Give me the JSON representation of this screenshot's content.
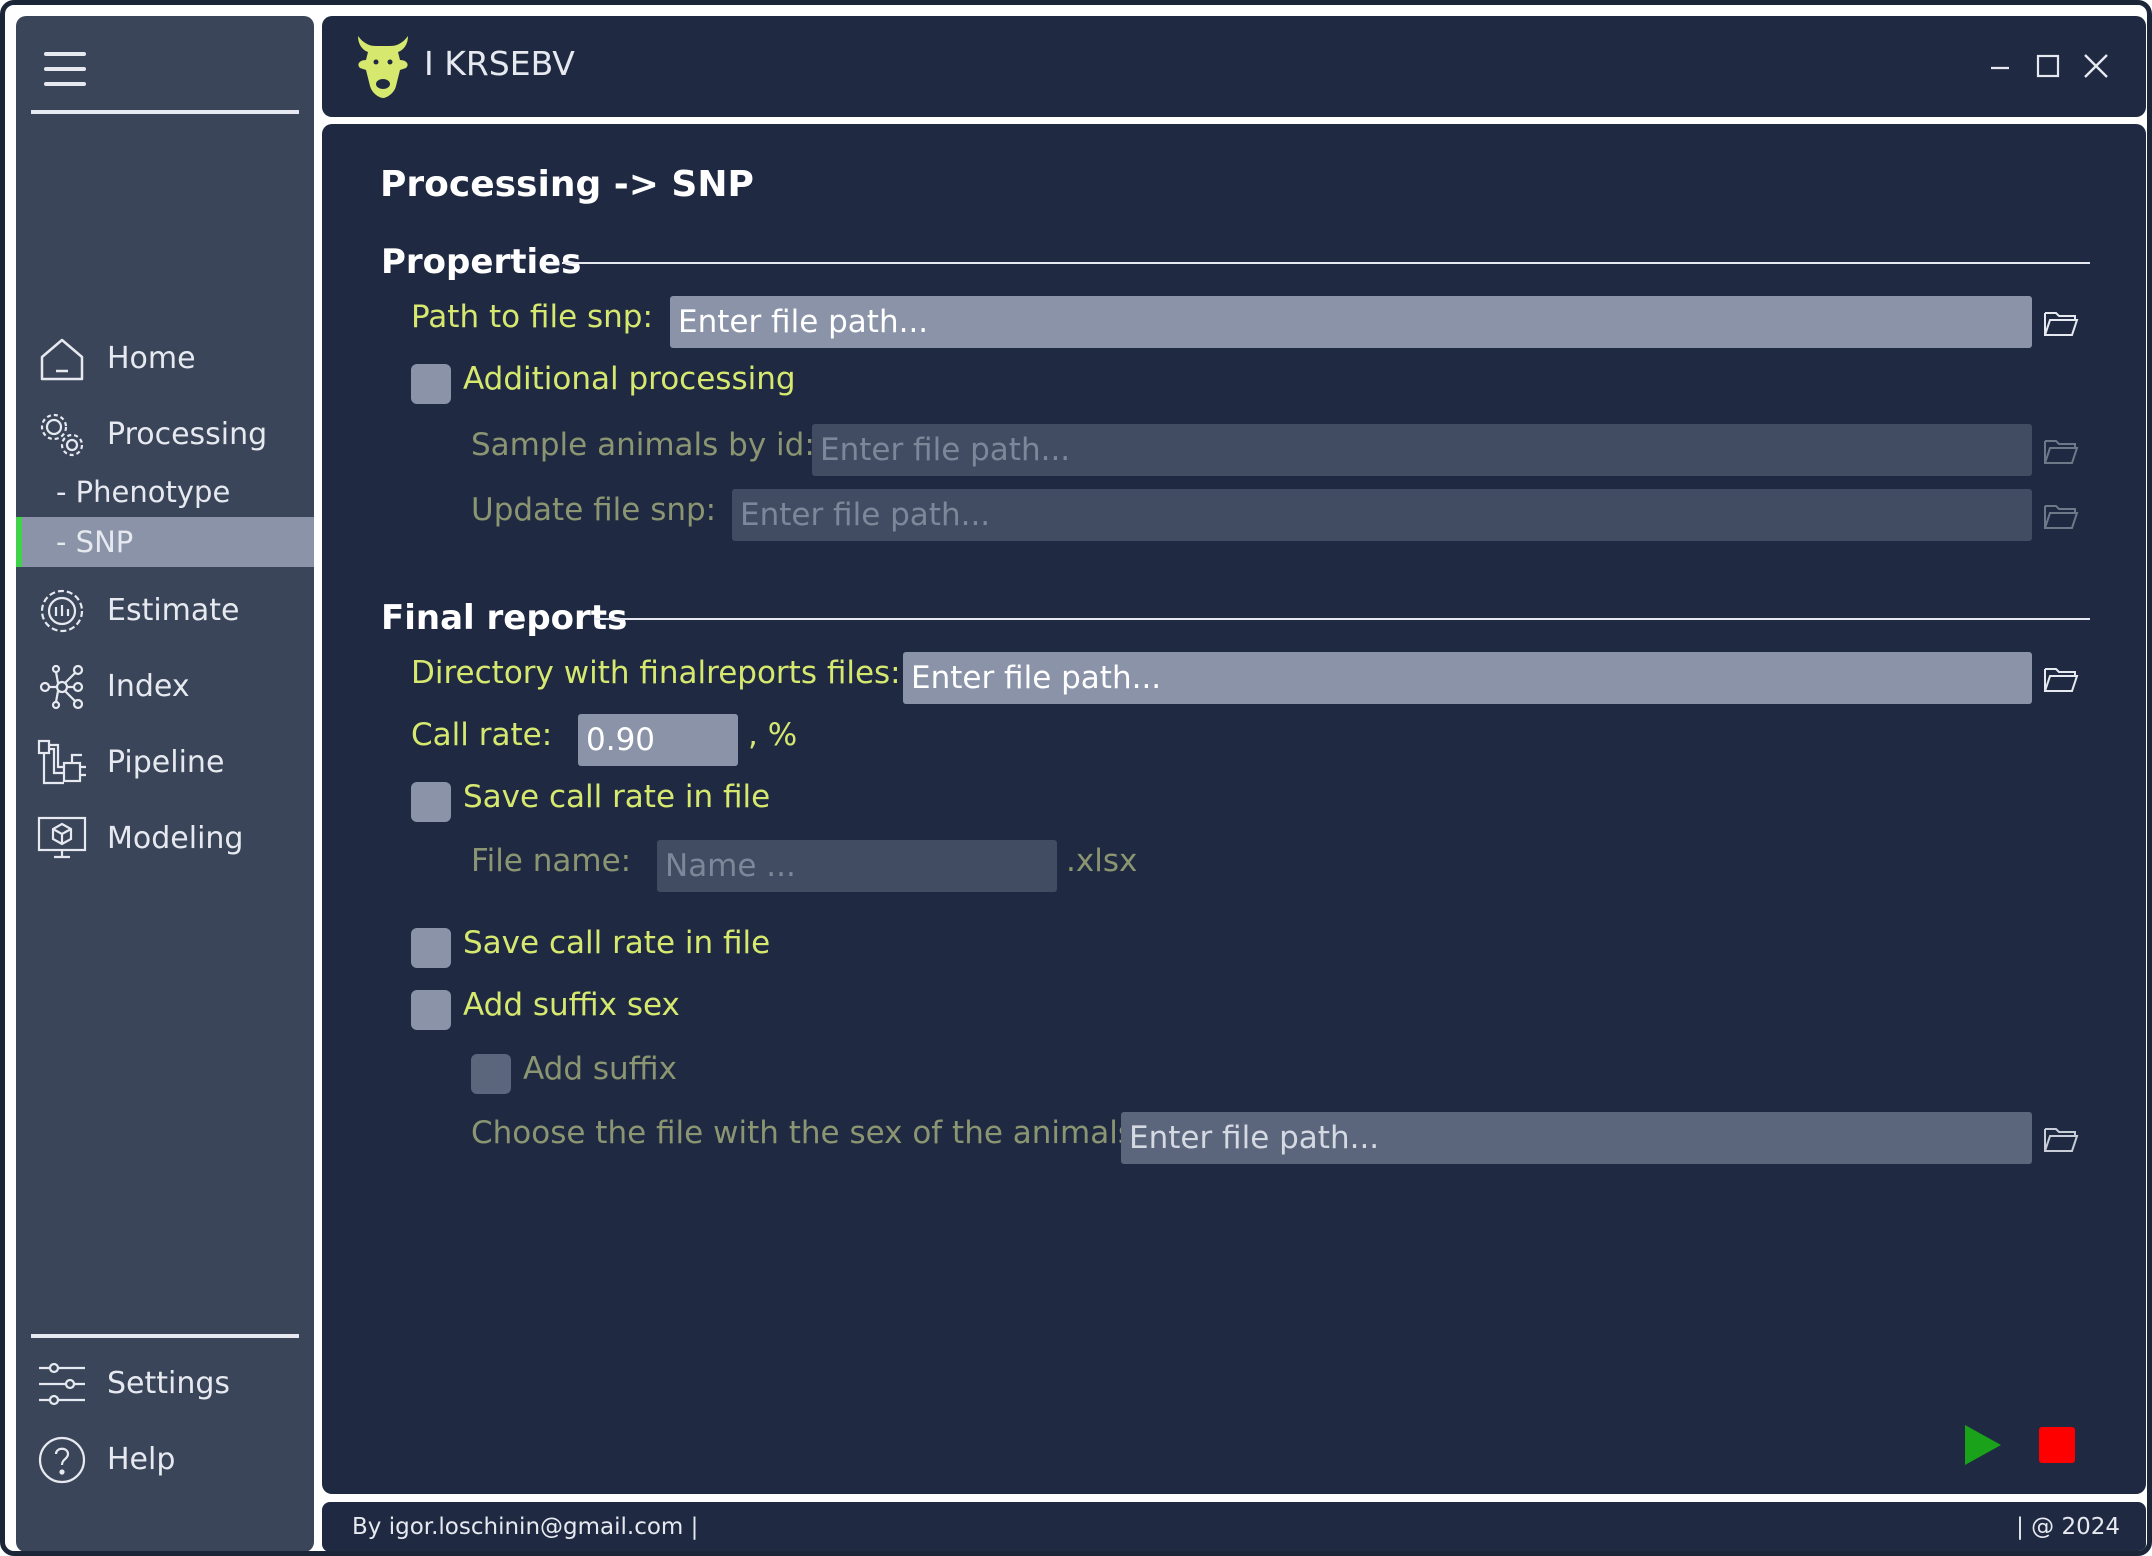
{
  "app": {
    "title": "KRSEBV",
    "title_prefix": "I"
  },
  "sidebar": {
    "items": [
      {
        "label": "Home",
        "icon": "home-icon"
      },
      {
        "label": "Processing",
        "icon": "gears-icon"
      },
      {
        "label": "- Phenotype"
      },
      {
        "label": "- SNP",
        "active": true
      },
      {
        "label": "Estimate",
        "icon": "estimate-icon"
      },
      {
        "label": "Index",
        "icon": "index-icon"
      },
      {
        "label": "Pipeline",
        "icon": "pipeline-icon"
      },
      {
        "label": "Modeling",
        "icon": "modeling-icon"
      }
    ],
    "bottom": [
      {
        "label": "Settings",
        "icon": "sliders-icon"
      },
      {
        "label": "Help",
        "icon": "help-icon"
      }
    ]
  },
  "page": {
    "title": "Processing -> SNP",
    "properties": {
      "title": "Properties",
      "path_label": "Path to file snp:",
      "path_placeholder": "Enter file path...",
      "additional_label": "Additional processing",
      "sample_label": "Sample animals by id:",
      "sample_placeholder": "Enter file path...",
      "update_label": "Update file snp:",
      "update_placeholder": "Enter file path..."
    },
    "final_reports": {
      "title": "Final reports",
      "dir_label": "Directory with finalreports files:",
      "dir_placeholder": "Enter file path...",
      "call_rate_label": "Call rate:",
      "call_rate_value": "0.90",
      "call_rate_unit": ", %",
      "save_call_rate_label": "Save call rate in file",
      "file_name_label": "File name:",
      "file_name_placeholder": "Name ...",
      "file_ext": ".xlsx",
      "save_call_rate_label_2": "Save call rate in file",
      "add_suffix_sex_label": "Add suffix sex",
      "add_suffix_label": "Add suffix",
      "sex_file_label": "Choose the file with the sex of the animals:",
      "sex_file_placeholder": "Enter file path..."
    }
  },
  "controls": {
    "run_color": "#1aa21a",
    "stop_color": "#ff0000"
  },
  "footer": {
    "left": "By igor.loschinin@gmail.com |",
    "right": "| @ 2024"
  },
  "colors": {
    "accent_label": "#d6e86e",
    "active_indicator": "#3fd24a",
    "panel": "#1f2a42",
    "sidebar": "#3a4559"
  }
}
